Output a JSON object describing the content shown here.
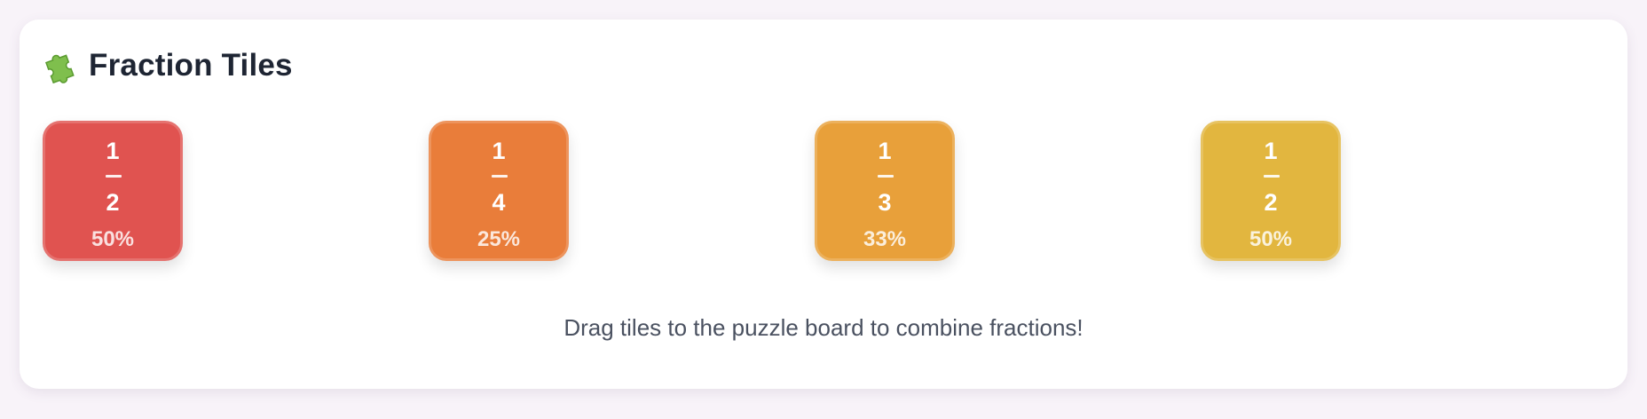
{
  "header": {
    "title": "Fraction Tiles",
    "icon": "puzzle-piece-icon"
  },
  "tiles": [
    {
      "numerator": "1",
      "denominator": "2",
      "percent": "50%",
      "color": "#e05350"
    },
    {
      "numerator": "1",
      "denominator": "4",
      "percent": "25%",
      "color": "#e97d3a"
    },
    {
      "numerator": "1",
      "denominator": "3",
      "percent": "33%",
      "color": "#e8a03a"
    },
    {
      "numerator": "1",
      "denominator": "2",
      "percent": "50%",
      "color": "#e2b63f"
    }
  ],
  "hint": "Drag tiles to the puzzle board to combine fractions!",
  "colors": {
    "background": "#f8f3f9",
    "panel": "#ffffff",
    "title": "#1e2533",
    "hint": "#4a5160"
  }
}
